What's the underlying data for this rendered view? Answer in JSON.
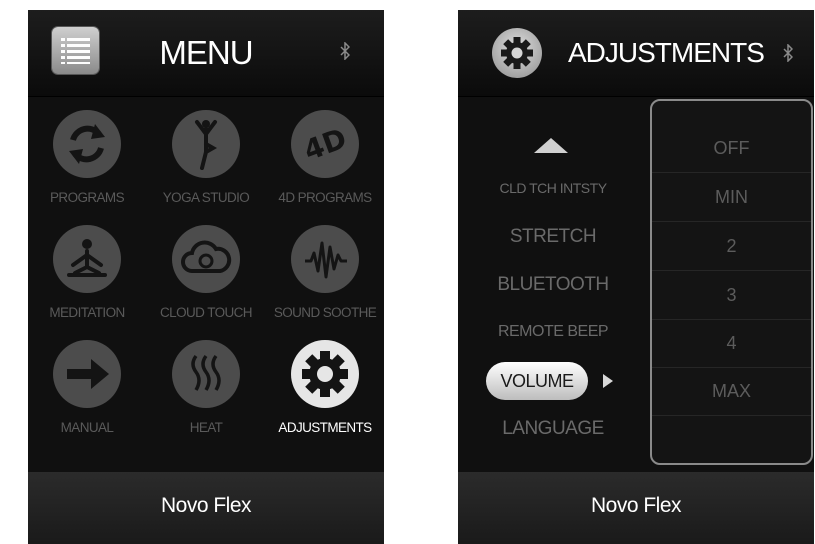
{
  "colors": {
    "background": "#101010",
    "inactive_icon": "#4c4c4c",
    "active_icon": "#e6e6e6",
    "inactive_text": "#5a5a5a",
    "active_text": "#ffffff"
  },
  "menu_screen": {
    "title": "MENU",
    "header_icon": "menu-list-icon",
    "bluetooth_icon": "bluetooth-icon",
    "items": [
      {
        "label": "PROGRAMS",
        "icon": "refresh-icon",
        "active": false
      },
      {
        "label": "YOGA STUDIO",
        "icon": "yoga-pose-icon",
        "active": false
      },
      {
        "label": "4D PROGRAMS",
        "icon": "4d-icon",
        "active": false
      },
      {
        "label": "MEDITATION",
        "icon": "meditation-icon",
        "active": false
      },
      {
        "label": "CLOUD TOUCH",
        "icon": "cloud-icon",
        "active": false
      },
      {
        "label": "SOUND SOOTHE",
        "icon": "sound-wave-icon",
        "active": false
      },
      {
        "label": "MANUAL",
        "icon": "arrow-right-icon",
        "active": false
      },
      {
        "label": "HEAT",
        "icon": "heat-icon",
        "active": false
      },
      {
        "label": "ADJUSTMENTS",
        "icon": "gear-icon",
        "active": true
      }
    ],
    "footer": "Novo Flex"
  },
  "adjustments_screen": {
    "title": "ADJUSTMENTS",
    "header_icon": "gear-icon",
    "bluetooth_icon": "bluetooth-icon",
    "settings": [
      "CLD TCH INTSTY",
      "STRETCH",
      "BLUETOOTH",
      "REMOTE BEEP",
      "VOLUME",
      "LANGUAGE"
    ],
    "selected_setting": "VOLUME",
    "volume_options": [
      "OFF",
      "MIN",
      "2",
      "3",
      "4",
      "MAX"
    ],
    "footer": "Novo Flex"
  }
}
